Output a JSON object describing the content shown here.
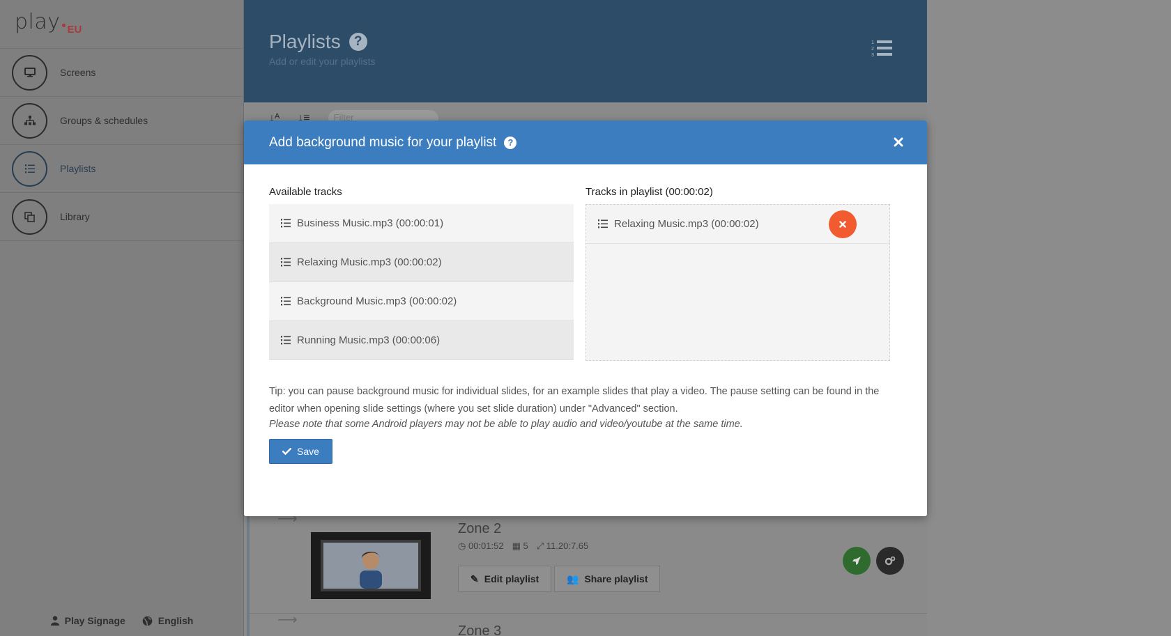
{
  "sidebar": {
    "logo": {
      "text": "play",
      "suffix": "EU"
    },
    "items": [
      {
        "label": "Screens",
        "icon": "monitor-icon"
      },
      {
        "label": "Groups & schedules",
        "icon": "sitemap-icon"
      },
      {
        "label": "Playlists",
        "icon": "list-icon",
        "active": true
      },
      {
        "label": "Library",
        "icon": "clone-icon"
      }
    ],
    "footer": {
      "user": "Play Signage",
      "language": "English"
    }
  },
  "main": {
    "title": "Playlists",
    "subtitle": "Add or edit your playlists",
    "filter_placeholder": "Filter",
    "zones": [
      {
        "title": "Zone 2",
        "duration": "00:01:52",
        "slides": "5",
        "ratio": "11.20:7.65",
        "edit_label": "Edit playlist",
        "share_label": "Share playlist"
      },
      {
        "title": "Zone 3"
      }
    ]
  },
  "modal": {
    "title": "Add background music for your playlist",
    "available_heading": "Available tracks",
    "playlist_heading": "Tracks in playlist (00:00:02)",
    "available_tracks": [
      "Business Music.mp3 (00:00:01)",
      "Relaxing Music.mp3 (00:00:02)",
      "Background Music.mp3 (00:00:02)",
      "Running Music.mp3 (00:00:06)"
    ],
    "playlist_tracks": [
      "Relaxing Music.mp3 (00:00:02)"
    ],
    "tip": "Tip: you can pause background music for individual slides, for an example slides that play a video. The pause setting can be found in the editor when opening slide settings (where you set slide duration) under \"Advanced\" section.",
    "note": "Please note that some Android players may not be able to play audio and video/youtube at the same time.",
    "save_label": "Save"
  },
  "colors": {
    "modal_header": "#3b7dbe",
    "remove_button": "#f25a2f",
    "brand_accent": "#a83a3a"
  }
}
